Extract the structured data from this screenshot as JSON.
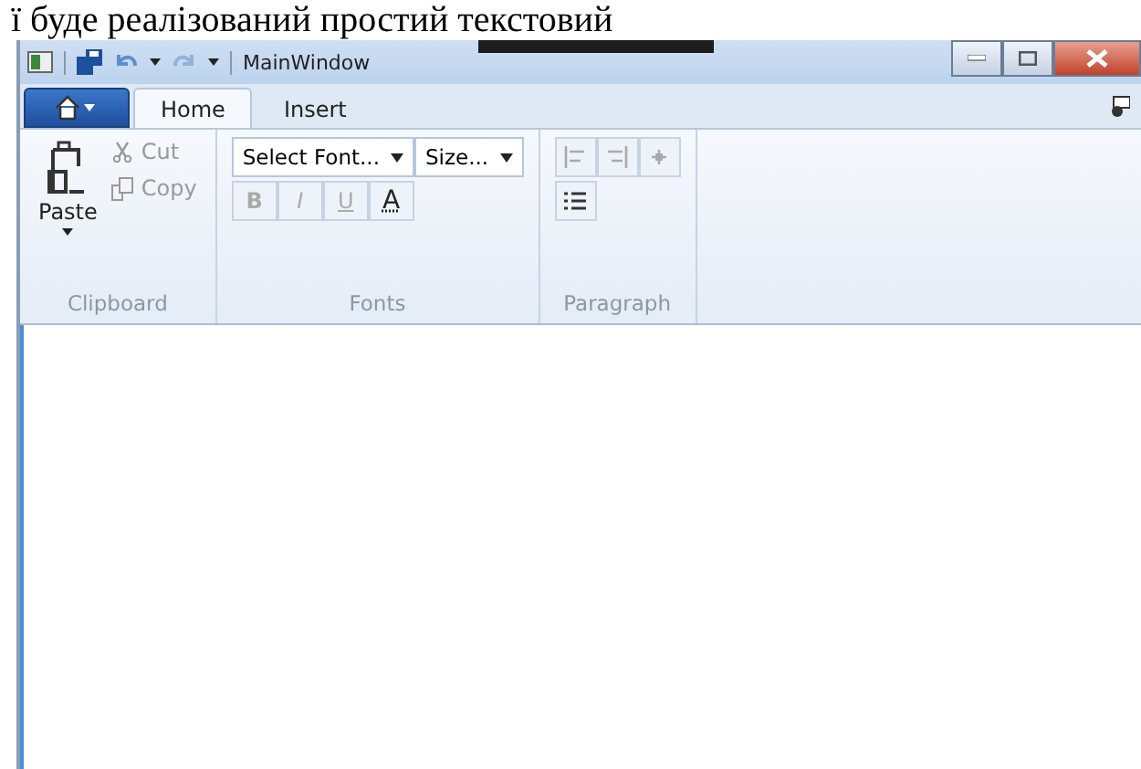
{
  "document_text": "ї буде реалізований простий текстовий",
  "window": {
    "title": "MainWindow"
  },
  "quick_access": [
    {
      "kind": "save"
    },
    {
      "kind": "undo"
    },
    {
      "kind": "dropdown"
    },
    {
      "kind": "redo"
    },
    {
      "kind": "dropdown"
    }
  ],
  "tabs": [
    {
      "label": "Home",
      "selected": true
    },
    {
      "label": "Insert",
      "selected": false
    }
  ],
  "groups": [
    {
      "kind": "clipboard",
      "label": "Clipboard",
      "paste": "Paste",
      "items": [
        {
          "label": "Cut",
          "disabled": true
        },
        {
          "label": "Copy",
          "disabled": true
        }
      ]
    },
    {
      "kind": "fonts",
      "label": "Fonts",
      "font_combo": "Select Font...",
      "size_combo": "Size...",
      "buttons": [
        {
          "glyph": "B",
          "disabled": true
        },
        {
          "glyph": "I",
          "disabled": true
        },
        {
          "glyph": "U",
          "disabled": true
        },
        {
          "glyph": "A",
          "disabled": false
        }
      ]
    },
    {
      "kind": "paragraph",
      "label": "Paragraph"
    }
  ]
}
